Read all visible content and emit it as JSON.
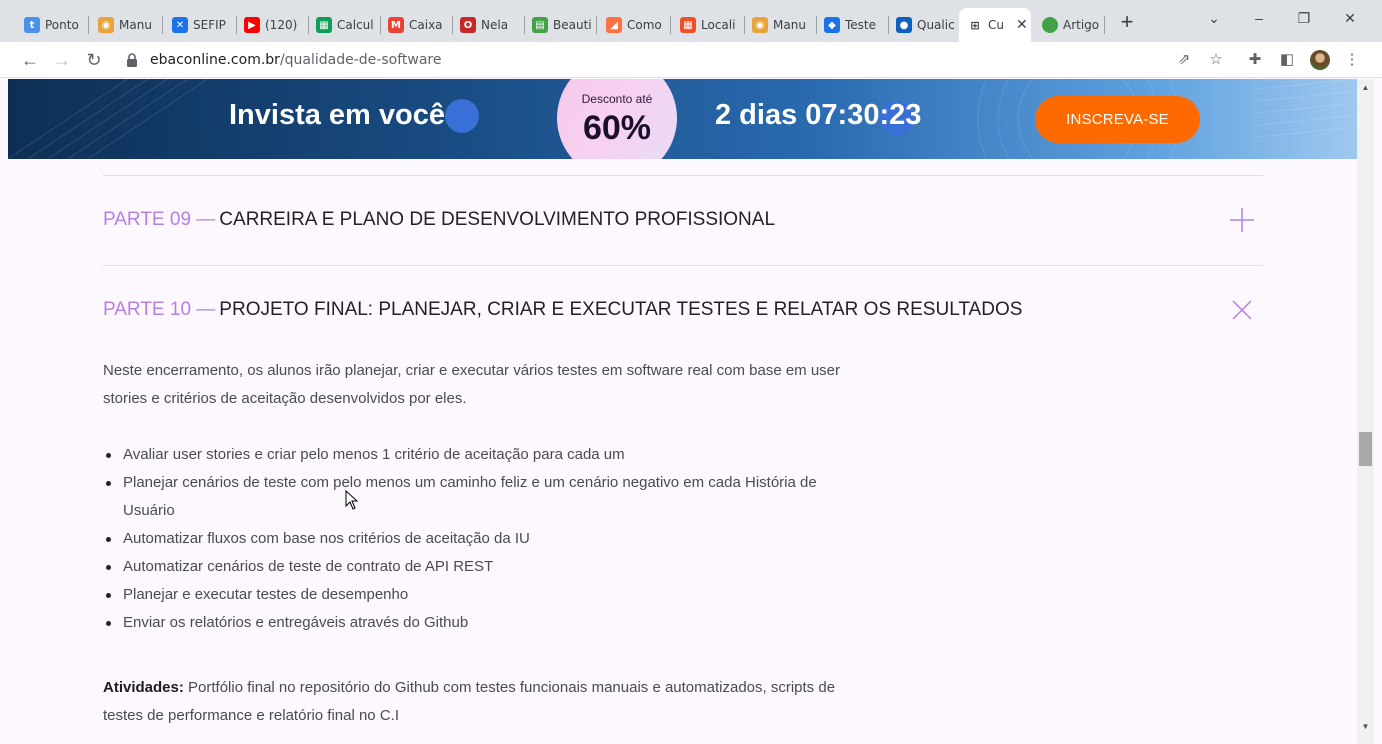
{
  "browser": {
    "tabs": [
      {
        "title": "Ponto",
        "icon": "t-icon",
        "color": "#4a8fe8"
      },
      {
        "title": "Manu",
        "icon": "eye-icon",
        "color": "#e8a33a"
      },
      {
        "title": "SEFIP",
        "icon": "butterfly-icon",
        "color": "#1a73e8"
      },
      {
        "title": "(120)",
        "icon": "youtube-icon",
        "color": "#ff0000"
      },
      {
        "title": "Calcul",
        "icon": "grid-icon",
        "color": "#0f9d58"
      },
      {
        "title": "Caixa",
        "icon": "gmail-icon",
        "color": "#ea4335"
      },
      {
        "title": "Nela",
        "icon": "opera-icon",
        "color": "#c62828"
      },
      {
        "title": "Beauti",
        "icon": "chart-icon",
        "color": "#43a047"
      },
      {
        "title": "Como",
        "icon": "pen-icon",
        "color": "#ff7043"
      },
      {
        "title": "Locali",
        "icon": "windows-icon",
        "color": "#f25022"
      },
      {
        "title": "Manu",
        "icon": "eye-icon",
        "color": "#e8a33a"
      },
      {
        "title": "Teste",
        "icon": "diamond-icon",
        "color": "#1a73e8"
      },
      {
        "title": "Qualic",
        "icon": "drop-icon",
        "color": "#0f5fbf"
      }
    ],
    "active_tab": {
      "title": "Cu",
      "icon": "qr-icon"
    },
    "last_tab": {
      "title": "Artigo",
      "icon": "globe-icon",
      "color": "#43a047"
    },
    "url_host": "ebaconline.com.br",
    "url_path": "/qualidade-de-software"
  },
  "banner": {
    "headline": "Invista em você",
    "discount_label": "Desconto até",
    "discount_value": "60%",
    "countdown": "2 dias 07:30:23",
    "cta": "INSCREVA-SE"
  },
  "sections": [
    {
      "number": "PARTE 09 —",
      "title": "CARREIRA E PLANO DE DESENVOLVIMENTO PROFISSIONAL",
      "expanded": false
    },
    {
      "number": "PARTE 10 —",
      "title": "PROJETO FINAL: PLANEJAR, CRIAR E EXECUTAR TESTES E RELATAR OS RESULTADOS",
      "expanded": true
    }
  ],
  "content": {
    "intro": "Neste encerramento, os alunos irão planejar, criar e executar vários testes em software real com base em user stories e critérios de aceitação desenvolvidos por eles.",
    "bullets": [
      "Avaliar user stories e criar pelo menos 1 critério de aceitação para cada um",
      "Planejar cenários de teste com pelo menos um caminho feliz e um cenário negativo em cada História de Usuário",
      "Automatizar fluxos com base nos critérios de aceitação da IU",
      "Automatizar cenários de teste de contrato de API REST",
      "Planejar e executar testes de desempenho",
      "Enviar os relatórios e entregáveis através do Github"
    ],
    "activities_label": "Atividades:",
    "activities_text": "Portfólio final no repositório do Github com testes funcionais manuais e automatizados, scripts de testes de performance e relatório final no C.I"
  },
  "colors": {
    "accent": "#b77fe0",
    "cta": "#ff6a00",
    "background": "#fdf8fe"
  }
}
